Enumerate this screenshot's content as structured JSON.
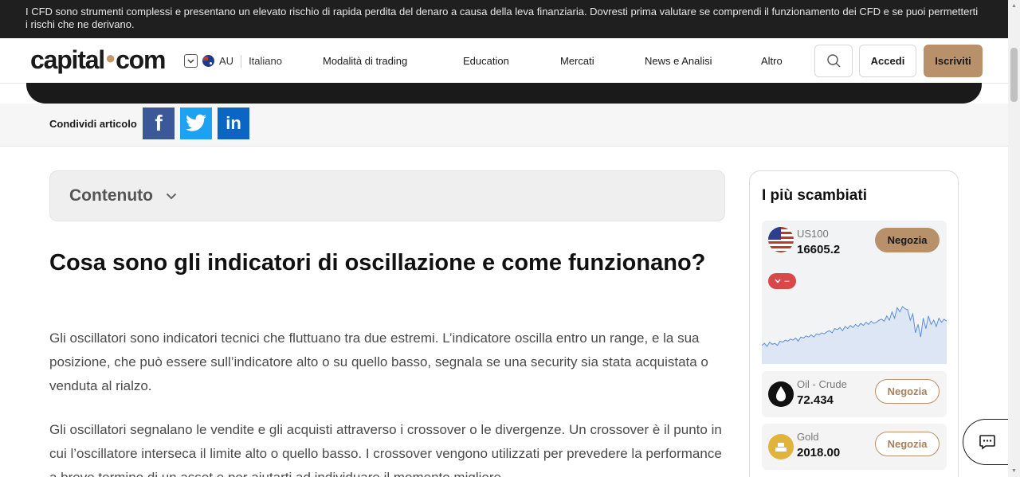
{
  "risk_banner": {
    "text": "I CFD sono strumenti complessi e presentano un elevato rischio di rapida perdita del denaro a causa della leva finanziaria. Dovresti prima valutare se comprendi il funzionamento dei CFD e se puoi permetterti i rischi che ne derivano."
  },
  "header": {
    "logo_left": "capital",
    "logo_dot": "●",
    "logo_right": "com",
    "region": "AU",
    "language": "Italiano",
    "nav": [
      "Modalità di trading",
      "Education",
      "Mercati",
      "News e Analisi",
      "Altro"
    ],
    "login_label": "Accedi",
    "signup_label": "Iscriviti"
  },
  "share": {
    "label": "Condividi articolo",
    "facebook": "f",
    "linkedin": "in"
  },
  "toc": {
    "title": "Contenuto"
  },
  "article": {
    "heading": "Cosa sono gli indicatori di oscillazione e come funzionano?",
    "paragraphs": [
      "Gli oscillatori sono indicatori tecnici che fluttuano tra due estremi. L’indicatore oscilla entro un range, e la sua posizione, che può essere sull’indicatore alto o su quello basso, segnala se una security sia stata acquistata o venduta al rialzo.",
      "Gli oscillatori segnalano le vendite e gli acquisti attraverso i crossover o le divergenze. Un crossover è il punto in cui l’oscillatore interseca il limite alto o quello basso. I crossover vengono utilizzati per prevedere la performance a breve termine di un asset e per aiutarti ad individuare il momento migliore"
    ]
  },
  "sidebar": {
    "title": "I più scambiati",
    "assets": [
      {
        "name": "US100",
        "price": "16605.2",
        "trade_label": "Negozia",
        "change": "–",
        "icon": "us-flag-icon"
      },
      {
        "name": "Oil - Crude",
        "price": "72.434",
        "trade_label": "Negozia",
        "icon": "oil-drop-icon"
      },
      {
        "name": "Gold",
        "price": "2018.00",
        "trade_label": "Negozia",
        "icon": "gold-bars-icon"
      }
    ],
    "sparkline": [
      38,
      36,
      39,
      35,
      37,
      36,
      38,
      34,
      35,
      33,
      34,
      32,
      33,
      31,
      34,
      30,
      31,
      29,
      30,
      28,
      30,
      27,
      28,
      26,
      27,
      25,
      24,
      26,
      22,
      23,
      21,
      24,
      20,
      22,
      19,
      21,
      18,
      20,
      17,
      19,
      16,
      18,
      15,
      17,
      16,
      14,
      13,
      15,
      10,
      14,
      6,
      12,
      2,
      6,
      1,
      3,
      4,
      14,
      8,
      26,
      18,
      30,
      12,
      22,
      10,
      18,
      14,
      20,
      12,
      16,
      13,
      15
    ]
  },
  "colors": {
    "accent": "#b8906a",
    "banner_bg": "#1f1f1f",
    "negative": "#d94848",
    "chart_line": "#5b8ed6"
  }
}
